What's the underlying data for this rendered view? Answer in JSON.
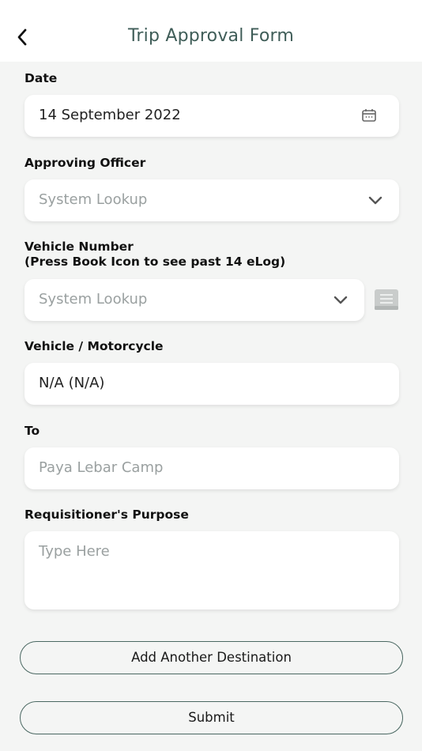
{
  "header": {
    "title": "Trip Approval Form"
  },
  "fields": {
    "date": {
      "label": "Date",
      "value": "14 September 2022"
    },
    "approving_officer": {
      "label": "Approving Officer",
      "placeholder": "System Lookup"
    },
    "vehicle_number": {
      "label_line1": "Vehicle Number",
      "label_line2": "(Press Book Icon to see past 14 eLog)",
      "placeholder": "System Lookup"
    },
    "vehicle_motorcycle": {
      "label": "Vehicle / Motorcycle",
      "value": "N/A (N/A)"
    },
    "to": {
      "label": "To",
      "placeholder": "Paya Lebar Camp"
    },
    "purpose": {
      "label": "Requisitioner's Purpose",
      "placeholder": "Type Here"
    }
  },
  "buttons": {
    "add_destination": "Add Another Destination",
    "submit": "Submit"
  },
  "icons": {
    "back": "chevron-left-icon",
    "calendar": "calendar-icon",
    "dropdown": "chevron-down-icon",
    "log_book": "book-icon"
  },
  "colors": {
    "title": "#3f5d58",
    "button_border": "#4a6862",
    "background": "#f4f5f4"
  }
}
